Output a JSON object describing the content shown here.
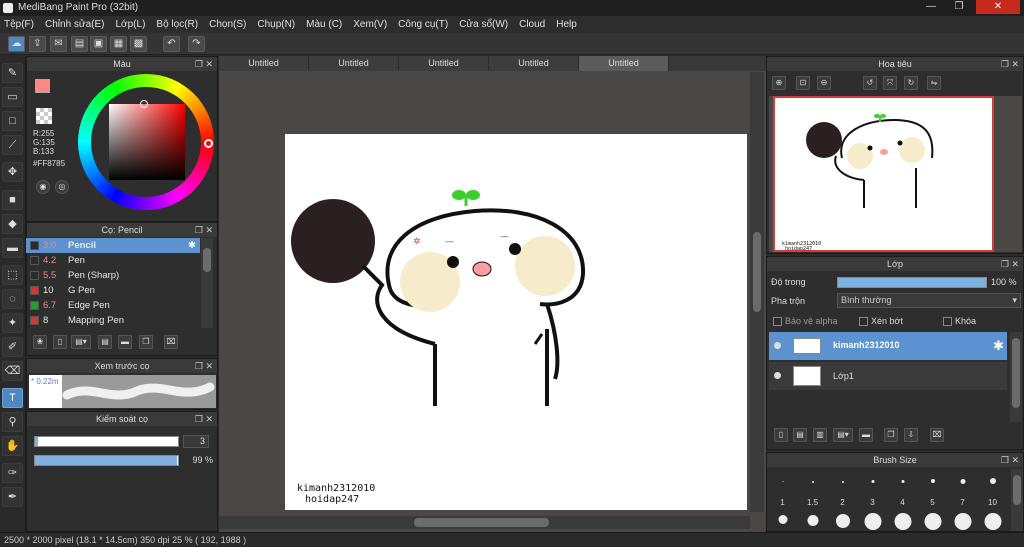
{
  "window": {
    "title": "MediBang Paint Pro (32bit)",
    "min": "—",
    "max": "❐",
    "close": "✕"
  },
  "menu": [
    "Tệp(F)",
    "Chỉnh sửa(E)",
    "Lớp(L)",
    "Bộ lọc(R)",
    "Chọn(S)",
    "Chụp(N)",
    "Màu (C)",
    "Xem(V)",
    "Công cụ(T)",
    "Cửa sổ(W)",
    "Cloud",
    "Help"
  ],
  "tabs": [
    "Untitled",
    "Untitled",
    "Untitled",
    "Untitled",
    "Untitled"
  ],
  "active_tab_index": 4,
  "color_panel": {
    "title": "Màu",
    "r": "R:255",
    "g": "G:135",
    "b": "B:133",
    "hex": "#FF8785",
    "fg_color": "#FF8785",
    "bg_color": "#ffffff"
  },
  "brush_panel": {
    "title": "Cọ: Pencil",
    "items": [
      {
        "size": "3.0",
        "name": "Pencil",
        "color": "#2a2a2a"
      },
      {
        "size": "4.2",
        "name": "Pen",
        "color": "#2a2a2a"
      },
      {
        "size": "5.5",
        "name": "Pen (Sharp)",
        "color": "#2a2a2a"
      },
      {
        "size": "10",
        "name": "G Pen",
        "color": "#e03030"
      },
      {
        "size": "6.7",
        "name": "Edge Pen",
        "color": "#22a030"
      },
      {
        "size": "8",
        "name": "Mapping Pen",
        "color": "#e03030"
      }
    ]
  },
  "preview_panel": {
    "title": "Xem trước cọ",
    "size_label": "* 0.22m"
  },
  "control_panel": {
    "title": "Kiểm soát cọ",
    "size_value": "3",
    "opacity_value": "99 %",
    "opacity_fraction": 0.99,
    "size_fraction": 0.02
  },
  "navigator": {
    "title": "Hoa tiêu"
  },
  "layer_panel": {
    "title": "Lớp",
    "opacity_label": "Độ trong",
    "opacity_value": "100 %",
    "opacity_fraction": 1.0,
    "blend_label": "Pha trộn",
    "blend_value": "Bình thường",
    "alpha_protect": "Bảo vệ alpha",
    "clipping": "Xén bớt",
    "lock": "Khóa",
    "layers": [
      {
        "name": "kimanh2312010",
        "selected": true
      },
      {
        "name": "Lớp1",
        "selected": false
      }
    ]
  },
  "brush_size_panel": {
    "title": "Brush Size",
    "sizes": [
      "1",
      "1.5",
      "2",
      "3",
      "4",
      "5",
      "7",
      "10"
    ]
  },
  "canvas_text": {
    "line1": "kimanh2312010",
    "line2": "hoidap247"
  },
  "navigator_text": {
    "line1": "kimanh2312010",
    "line2": "hoidap247"
  },
  "status": "2500 * 2000 pixel   (18.1 * 14.5cm)   350 dpi   25 %   ( 192, 1988 )"
}
